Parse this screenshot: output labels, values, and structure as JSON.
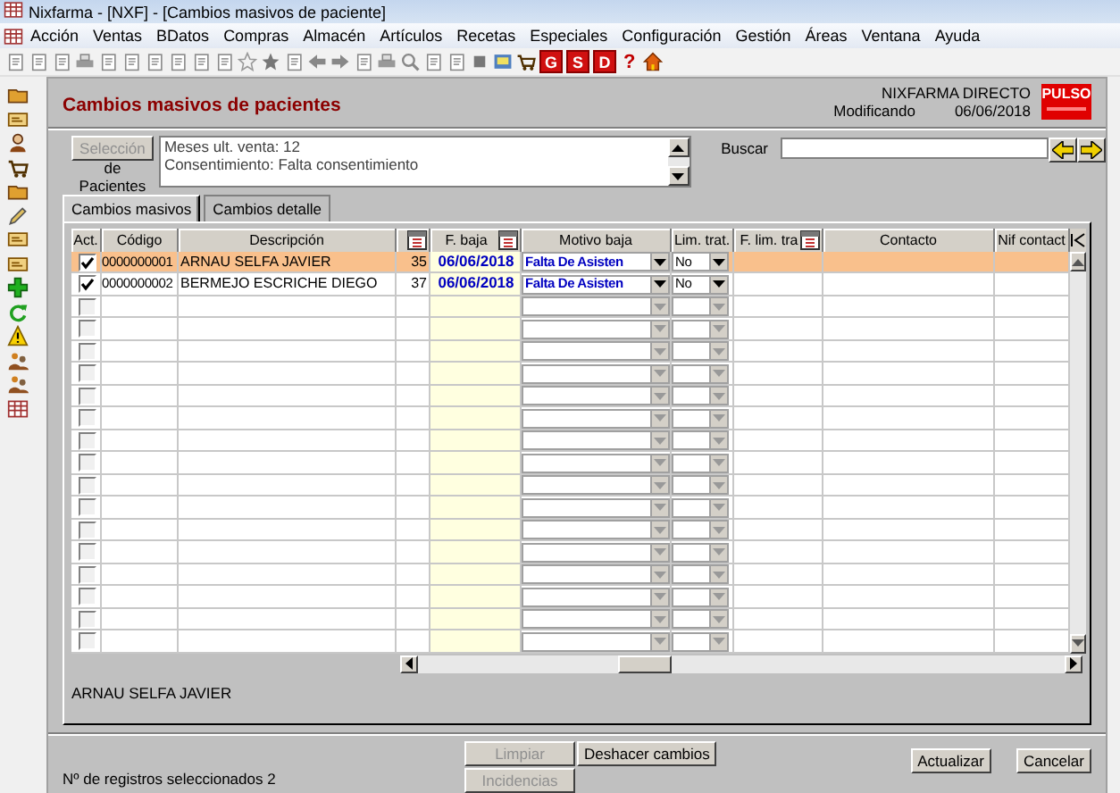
{
  "window": {
    "title": "Nixfarma - [NXF] - [Cambios masivos de paciente]"
  },
  "menu": [
    "Acción",
    "Ventas",
    "BDatos",
    "Compras",
    "Almacén",
    "Artículos",
    "Recetas",
    "Especiales",
    "Configuración",
    "Gestión",
    "Áreas",
    "Ventana",
    "Ayuda"
  ],
  "toolbar": {
    "letter_buttons": [
      "G",
      "S",
      "D"
    ],
    "help": "?"
  },
  "form": {
    "title": "Cambios masivos de pacientes",
    "app": "NIXFARMA DIRECTO",
    "mode": "Modificando",
    "date": "06/06/2018",
    "logo": "PULSO"
  },
  "selection": {
    "button": {
      "label": "Selección",
      "disabled": true
    },
    "caption": "de Pacientes",
    "criteria": [
      "Meses ult. venta: 12",
      "Consentimiento: Falta consentimiento"
    ]
  },
  "search": {
    "label": "Buscar"
  },
  "tabs": [
    {
      "label": "Cambios masivos",
      "selected": true
    },
    {
      "label": "Cambios detalle",
      "selected": false
    }
  ],
  "grid": {
    "columns": [
      {
        "label": "Act."
      },
      {
        "label": "Código"
      },
      {
        "label": "Descripción"
      },
      {
        "calendar": true
      },
      {
        "label": "F. baja",
        "calendar": true
      },
      {
        "label": "Motivo baja"
      },
      {
        "label": "Lim. trat."
      },
      {
        "label": "F. lim. tra",
        "calendar": true
      },
      {
        "label": "Contacto"
      },
      {
        "label": "Nif contact"
      }
    ],
    "rows": [
      {
        "checked": true,
        "selected": true,
        "code": "0000000001",
        "description": "ARNAU SELFA JAVIER",
        "column_4": "35",
        "f_baja": "06/06/2018",
        "motivo_baja": "Falta De Asisten",
        "lim_trat": "No"
      },
      {
        "checked": true,
        "selected": false,
        "code": "0000000002",
        "description": "BERMEJO ESCRICHE DIEGO",
        "column_4": "37",
        "f_baja": "06/06/2018",
        "motivo_baja": "Falta De Asisten",
        "lim_trat": "No"
      },
      {
        "checked": false,
        "selected": false
      },
      {
        "checked": false,
        "selected": false
      },
      {
        "checked": false,
        "selected": false
      },
      {
        "checked": false,
        "selected": false
      },
      {
        "checked": false,
        "selected": false
      },
      {
        "checked": false,
        "selected": false
      },
      {
        "checked": false,
        "selected": false
      },
      {
        "checked": false,
        "selected": false
      },
      {
        "checked": false,
        "selected": false
      },
      {
        "checked": false,
        "selected": false
      },
      {
        "checked": false,
        "selected": false
      },
      {
        "checked": false,
        "selected": false
      },
      {
        "checked": false,
        "selected": false
      },
      {
        "checked": false,
        "selected": false
      },
      {
        "checked": false,
        "selected": false
      },
      {
        "checked": false,
        "selected": false
      }
    ]
  },
  "current_patient": "ARNAU SELFA JAVIER",
  "buttons": [
    {
      "label": "Limpiar",
      "disabled": true,
      "kind": "stack"
    },
    {
      "label": "Incidencias",
      "disabled": true,
      "kind": "stack"
    },
    {
      "label": "Deshacer cambios",
      "disabled": false,
      "kind": "side"
    },
    {
      "label": "Actualizar",
      "disabled": false,
      "kind": "action"
    },
    {
      "label": "Cancelar",
      "disabled": false,
      "kind": "action"
    }
  ],
  "status": "Nº de registros seleccionados 2"
}
